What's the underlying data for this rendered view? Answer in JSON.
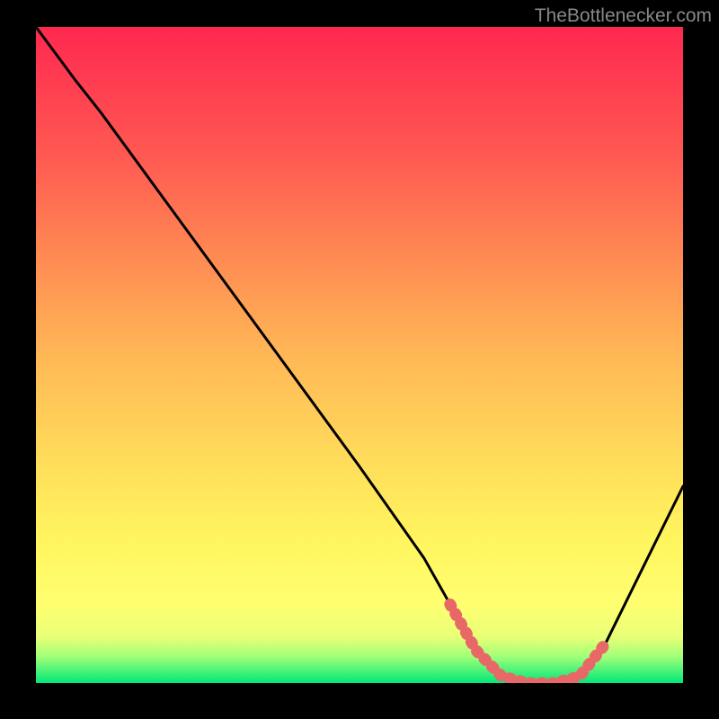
{
  "watermark": "TheBottlenecker.com",
  "chart_data": {
    "type": "line",
    "title": "",
    "xlabel": "",
    "ylabel": "",
    "xlim": [
      0,
      100
    ],
    "ylim": [
      0,
      100
    ],
    "series": [
      {
        "name": "curve",
        "x": [
          0,
          6,
          10,
          20,
          30,
          40,
          50,
          60,
          64,
          68,
          72,
          76,
          80,
          84,
          88,
          100
        ],
        "y": [
          100,
          92,
          87,
          73.5,
          60,
          46.5,
          33,
          19,
          12,
          5,
          1,
          0,
          0,
          1,
          6,
          30
        ]
      }
    ],
    "highlighted_points": {
      "x": [
        64,
        68,
        72,
        76,
        80,
        84,
        88
      ],
      "y": [
        12,
        5,
        1,
        0,
        0,
        1,
        6
      ]
    },
    "gradient_colors": {
      "top": "#ff2850",
      "upper_mid": "#ff7853",
      "mid": "#ffb756",
      "lower_mid": "#ffe05a",
      "lower": "#ffff60",
      "bottom_band": "#b8ff70",
      "bottom": "#00ff80"
    }
  }
}
